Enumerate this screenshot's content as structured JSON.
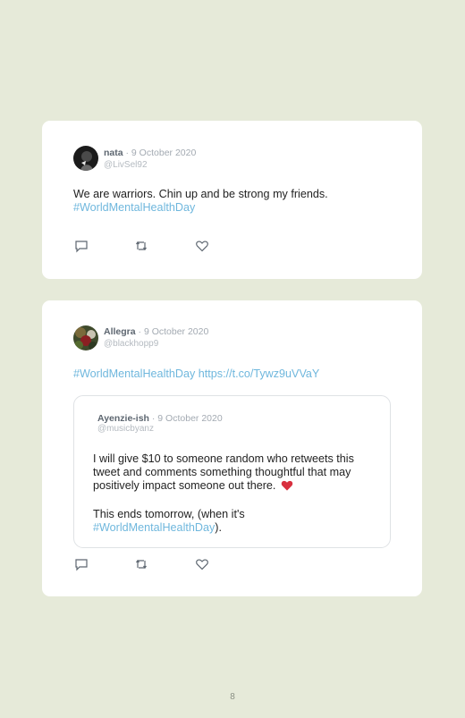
{
  "tweets": [
    {
      "author": "nata",
      "date": "· 9 October 2020",
      "handle": "@LivSel92",
      "text": "We are warriors. Chin up and be strong my friends.",
      "hashtag": "#WorldMentalHealthDay"
    },
    {
      "author": "Allegra",
      "date": "· 9 October 2020",
      "handle": "@blackhopp9",
      "hashtag": "#WorldMentalHealthDay",
      "link": "https://t.co/Tywz9uVVaY",
      "quoted": {
        "author": "Ayenzie-ish",
        "date": "· 9 October 2020",
        "handle": "@musicbyanz",
        "line1": "I will give $10 to someone random who retweets this",
        "line2": "tweet and comments something thoughtful that may",
        "line3": "positively impact someone out there.",
        "line4": "This ends tomorrow, (when it's",
        "hashtag": "#WorldMentalHealthDay",
        "after_hashtag": ")."
      }
    }
  ],
  "icons": [
    "reply-icon",
    "retweet-icon",
    "like-icon",
    "heart-emoji-icon"
  ],
  "colors": {
    "background": "#e6ead9",
    "card": "#ffffff",
    "hashtag": "#6fb7dd",
    "heart": "#d8303f"
  },
  "page_number": "8"
}
